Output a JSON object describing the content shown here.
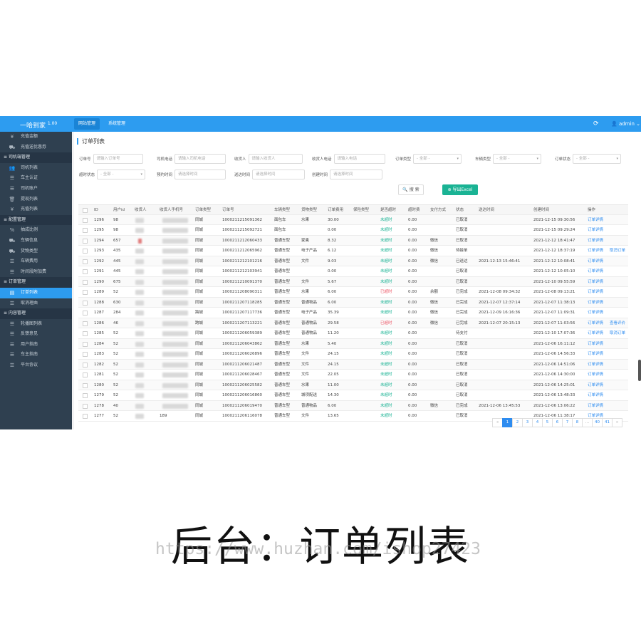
{
  "app": {
    "logo": "一哈到家",
    "version": "1.00",
    "top_nav": [
      "网站管理",
      "系统管理"
    ],
    "user": "admin"
  },
  "sidebar": [
    {
      "type": "item",
      "icon": "yen-icon",
      "glyph": "¥",
      "label": "充值金额"
    },
    {
      "type": "item",
      "icon": "car-icon",
      "glyph": "⛟",
      "label": "充值送优惠券"
    },
    {
      "type": "group",
      "label": "司机端管理"
    },
    {
      "type": "item",
      "icon": "users-icon",
      "glyph": "👥",
      "label": "司机列表"
    },
    {
      "type": "item",
      "icon": "list-icon",
      "glyph": "☰",
      "label": "车主认证"
    },
    {
      "type": "item",
      "icon": "list-icon",
      "glyph": "☰",
      "label": "司机账户"
    },
    {
      "type": "item",
      "icon": "trash-icon",
      "glyph": "🗑",
      "label": "提现列表"
    },
    {
      "type": "item",
      "icon": "yen-icon",
      "glyph": "¥",
      "label": "充值列表"
    },
    {
      "type": "group",
      "label": "配置管理"
    },
    {
      "type": "item",
      "icon": "percent-icon",
      "glyph": "%",
      "label": "抽成比例"
    },
    {
      "type": "item",
      "icon": "car-icon",
      "glyph": "⛟",
      "label": "车辆信息"
    },
    {
      "type": "item",
      "icon": "car-icon",
      "glyph": "⛟",
      "label": "货物类型"
    },
    {
      "type": "item",
      "icon": "list-icon",
      "glyph": "☰",
      "label": "车辆费用"
    },
    {
      "type": "item",
      "icon": "list-icon",
      "glyph": "☰",
      "label": "时间段附加费"
    },
    {
      "type": "group",
      "label": "订单管理"
    },
    {
      "type": "item",
      "icon": "order-icon",
      "glyph": "▤",
      "label": "订单列表",
      "active": true
    },
    {
      "type": "item",
      "icon": "list-icon",
      "glyph": "☰",
      "label": "取消理由"
    },
    {
      "type": "group",
      "label": "内容管理"
    },
    {
      "type": "item",
      "icon": "list-icon",
      "glyph": "☰",
      "label": "轮播图列表"
    },
    {
      "type": "item",
      "icon": "list-icon",
      "glyph": "☰",
      "label": "反馈意见"
    },
    {
      "type": "item",
      "icon": "list-icon",
      "glyph": "☰",
      "label": "用户指南"
    },
    {
      "type": "item",
      "icon": "list-icon",
      "glyph": "☰",
      "label": "车主指南"
    },
    {
      "type": "item",
      "icon": "list-icon",
      "glyph": "☰",
      "label": "平台协议"
    }
  ],
  "page_title": "订单列表",
  "filters": {
    "row1": [
      {
        "label": "订单号",
        "placeholder": "请输入订单号"
      },
      {
        "label": "司机电话",
        "placeholder": "请输入司机电话"
      },
      {
        "label": "收货人",
        "placeholder": "请输入收货人"
      },
      {
        "label": "收货人电话",
        "placeholder": "请输入电话"
      },
      {
        "label": "订单类型",
        "placeholder": "- 全部 -",
        "select": true
      },
      {
        "label": "车辆类型",
        "placeholder": "- 全部 -",
        "select": true
      },
      {
        "label": "订单状态",
        "placeholder": "- 全部 -",
        "select": true
      }
    ],
    "row2": [
      {
        "label": "超时状态",
        "placeholder": "- 全部 -",
        "select": true
      },
      {
        "label": "预约时间",
        "placeholder": "请选择时间"
      },
      {
        "label": "送达时间",
        "placeholder": "请选择时间"
      },
      {
        "label": "创建时间",
        "placeholder": "请选择时间"
      }
    ],
    "search_label": "搜 索",
    "export_label": "导出Excel"
  },
  "table": {
    "columns": [
      "ID",
      "用户id",
      "收货人",
      "收货人手机号",
      "订单类型",
      "订单号",
      "车辆类型",
      "货物类型",
      "订单费用",
      "保险类型",
      "是否超时",
      "超时费",
      "支付方式",
      "状态",
      "送达时间",
      "创建时间",
      "操作"
    ],
    "rows": [
      {
        "id": "1296",
        "uid": "98",
        "otype": "同城",
        "no": "1000211215091362",
        "car": "面包车",
        "goods": "水果",
        "fee": "30.00",
        "ins": "",
        "late": "未超时",
        "lfee": "0.00",
        "pay": "",
        "status": "已取消",
        "deliver": "",
        "created": "2021-12-15 09:30:56",
        "ops": [
          "订单详情"
        ]
      },
      {
        "id": "1295",
        "uid": "98",
        "otype": "同城",
        "no": "1000211215092721",
        "car": "面包车",
        "goods": "",
        "fee": "0.00",
        "ins": "",
        "late": "未超时",
        "lfee": "0.00",
        "pay": "",
        "status": "已取消",
        "deliver": "",
        "created": "2021-12-15 09:29:24",
        "ops": [
          "订单详情"
        ]
      },
      {
        "id": "1294",
        "uid": "657",
        "otype": "同城",
        "no": "1000211212060433",
        "car": "普通车型",
        "goods": "家禽",
        "fee": "8.32",
        "ins": "",
        "late": "未超时",
        "lfee": "0.00",
        "pay": "微信",
        "status": "已取消",
        "deliver": "",
        "created": "2021-12-12 18:41:47",
        "ops": [
          "订单详情"
        ]
      },
      {
        "id": "1293",
        "uid": "435",
        "otype": "同城",
        "no": "1000211212065962",
        "car": "普通车型",
        "goods": "电子产品",
        "fee": "6.12",
        "ins": "",
        "late": "未超时",
        "lfee": "0.00",
        "pay": "微信",
        "status": "待接单",
        "deliver": "",
        "created": "2021-12-12 18:37:19",
        "ops": [
          "订单详情",
          "取消订单"
        ]
      },
      {
        "id": "1292",
        "uid": "445",
        "otype": "同城",
        "no": "1000211212101216",
        "car": "普通车型",
        "goods": "文件",
        "fee": "9.03",
        "ins": "",
        "late": "未超时",
        "lfee": "0.00",
        "pay": "微信",
        "status": "已送达",
        "deliver": "2021-12-13 15:46:41",
        "created": "2021-12-12 10:08:41",
        "ops": [
          "订单详情"
        ]
      },
      {
        "id": "1291",
        "uid": "445",
        "otype": "同城",
        "no": "1000211212103941",
        "car": "普通车型",
        "goods": "",
        "fee": "0.00",
        "ins": "",
        "late": "未超时",
        "lfee": "0.00",
        "pay": "",
        "status": "已取消",
        "deliver": "",
        "created": "2021-12-12 10:05:10",
        "ops": [
          "订单详情"
        ]
      },
      {
        "id": "1290",
        "uid": "675",
        "otype": "同城",
        "no": "1000211210091370",
        "car": "普通车型",
        "goods": "文件",
        "fee": "5.67",
        "ins": "",
        "late": "未超时",
        "lfee": "0.00",
        "pay": "",
        "status": "已取消",
        "deliver": "",
        "created": "2021-12-10 09:55:59",
        "ops": [
          "订单详情"
        ]
      },
      {
        "id": "1289",
        "uid": "52",
        "otype": "同城",
        "no": "1000211208090311",
        "car": "普通车型",
        "goods": "水果",
        "fee": "6.00",
        "ins": "",
        "late": "已超时",
        "lfee": "0.00",
        "pay": "余额",
        "status": "已完成",
        "deliver": "2021-12-08 09:34:32",
        "created": "2021-12-08 09:13:21",
        "ops": [
          "订单详情"
        ]
      },
      {
        "id": "1288",
        "uid": "630",
        "otype": "同城",
        "no": "1000211207118285",
        "car": "普通车型",
        "goods": "普通物品",
        "fee": "6.00",
        "ins": "",
        "late": "未超时",
        "lfee": "0.00",
        "pay": "微信",
        "status": "已完成",
        "deliver": "2021-12-07 12:37:14",
        "created": "2021-12-07 11:38:13",
        "ops": [
          "订单详情"
        ]
      },
      {
        "id": "1287",
        "uid": "284",
        "otype": "跨城",
        "no": "1000211207117736",
        "car": "普通车型",
        "goods": "电子产品",
        "fee": "35.39",
        "ins": "",
        "late": "未超时",
        "lfee": "0.00",
        "pay": "微信",
        "status": "已完成",
        "deliver": "2021-12-09 16:16:36",
        "created": "2021-12-07 11:09:31",
        "ops": [
          "订单详情"
        ]
      },
      {
        "id": "1286",
        "uid": "46",
        "otype": "跨城",
        "no": "1000211207113221",
        "car": "普通车型",
        "goods": "普通物品",
        "fee": "29.58",
        "ins": "",
        "late": "已超时",
        "lfee": "0.00",
        "pay": "微信",
        "status": "已完成",
        "deliver": "2021-12-07 20:15:13",
        "created": "2021-12-07 11:03:56",
        "ops": [
          "订单详情",
          "查看评价"
        ]
      },
      {
        "id": "1285",
        "uid": "52",
        "otype": "同城",
        "no": "1000211206059389",
        "car": "普通车型",
        "goods": "普通物品",
        "fee": "11.20",
        "ins": "",
        "late": "未超时",
        "lfee": "0.00",
        "pay": "",
        "status": "待支付",
        "deliver": "",
        "created": "2021-12-10 17:07:36",
        "ops": [
          "订单详情",
          "取消订单"
        ]
      },
      {
        "id": "1284",
        "uid": "52",
        "otype": "同城",
        "no": "1000211206043862",
        "car": "普通车型",
        "goods": "水果",
        "fee": "5.40",
        "ins": "",
        "late": "未超时",
        "lfee": "0.00",
        "pay": "",
        "status": "已取消",
        "deliver": "",
        "created": "2021-12-06 16:11:12",
        "ops": [
          "订单详情"
        ]
      },
      {
        "id": "1283",
        "uid": "52",
        "otype": "同城",
        "no": "1000211206026896",
        "car": "普通车型",
        "goods": "文件",
        "fee": "24.15",
        "ins": "",
        "late": "未超时",
        "lfee": "0.00",
        "pay": "",
        "status": "已取消",
        "deliver": "",
        "created": "2021-12-06 14:56:33",
        "ops": [
          "订单详情"
        ]
      },
      {
        "id": "1282",
        "uid": "52",
        "otype": "同城",
        "no": "1000211206021487",
        "car": "普通车型",
        "goods": "文件",
        "fee": "24.15",
        "ins": "",
        "late": "未超时",
        "lfee": "0.00",
        "pay": "",
        "status": "已取消",
        "deliver": "",
        "created": "2021-12-06 14:51:06",
        "ops": [
          "订单详情"
        ]
      },
      {
        "id": "1281",
        "uid": "52",
        "otype": "同城",
        "no": "1000211206028467",
        "car": "普通车型",
        "goods": "文件",
        "fee": "22.05",
        "ins": "",
        "late": "未超时",
        "lfee": "0.00",
        "pay": "",
        "status": "已取消",
        "deliver": "",
        "created": "2021-12-06 14:30:00",
        "ops": [
          "订单详情"
        ]
      },
      {
        "id": "1280",
        "uid": "52",
        "otype": "同城",
        "no": "1000211206025582",
        "car": "普通车型",
        "goods": "水果",
        "fee": "11.00",
        "ins": "",
        "late": "未超时",
        "lfee": "0.00",
        "pay": "",
        "status": "已取消",
        "deliver": "",
        "created": "2021-12-06 14:25:01",
        "ops": [
          "订单详情"
        ]
      },
      {
        "id": "1279",
        "uid": "52",
        "otype": "同城",
        "no": "1000211206016860",
        "car": "普通车型",
        "goods": "城项配送",
        "fee": "14.30",
        "ins": "",
        "late": "未超时",
        "lfee": "0.00",
        "pay": "",
        "status": "已取消",
        "deliver": "",
        "created": "2021-12-06 13:48:33",
        "ops": [
          "订单详情"
        ]
      },
      {
        "id": "1278",
        "uid": "40",
        "otype": "同城",
        "no": "1000211206019470",
        "car": "普通车型",
        "goods": "普通物品",
        "fee": "6.00",
        "ins": "",
        "late": "未超时",
        "lfee": "0.00",
        "pay": "微信",
        "status": "已完成",
        "deliver": "2021-12-06 13:45:53",
        "created": "2021-12-06 13:06:22",
        "ops": [
          "订单详情"
        ]
      },
      {
        "id": "1277",
        "uid": "52",
        "otype": "同城",
        "no": "1000211206116078",
        "car": "普通车型",
        "goods": "文件",
        "fee": "13.65",
        "ins": "",
        "late": "未超时",
        "lfee": "0.00",
        "pay": "",
        "status": "已取消",
        "deliver": "",
        "created": "2021-12-06 11:38:17",
        "ops": [
          "订单详情"
        ]
      }
    ],
    "phone_partial_last_row": "189"
  },
  "pagination": [
    "«",
    "1",
    "2",
    "3",
    "4",
    "5",
    "6",
    "7",
    "8",
    "...",
    "40",
    "41",
    "»"
  ],
  "pagination_active": "1",
  "caption": "后台：订单列表",
  "watermark": "https://www.huzhan.com/ishop27423",
  "colors": {
    "primary": "#2d9cf0",
    "sidebar": "#2f4050",
    "success": "#1ab394",
    "danger": "#ed5565"
  }
}
